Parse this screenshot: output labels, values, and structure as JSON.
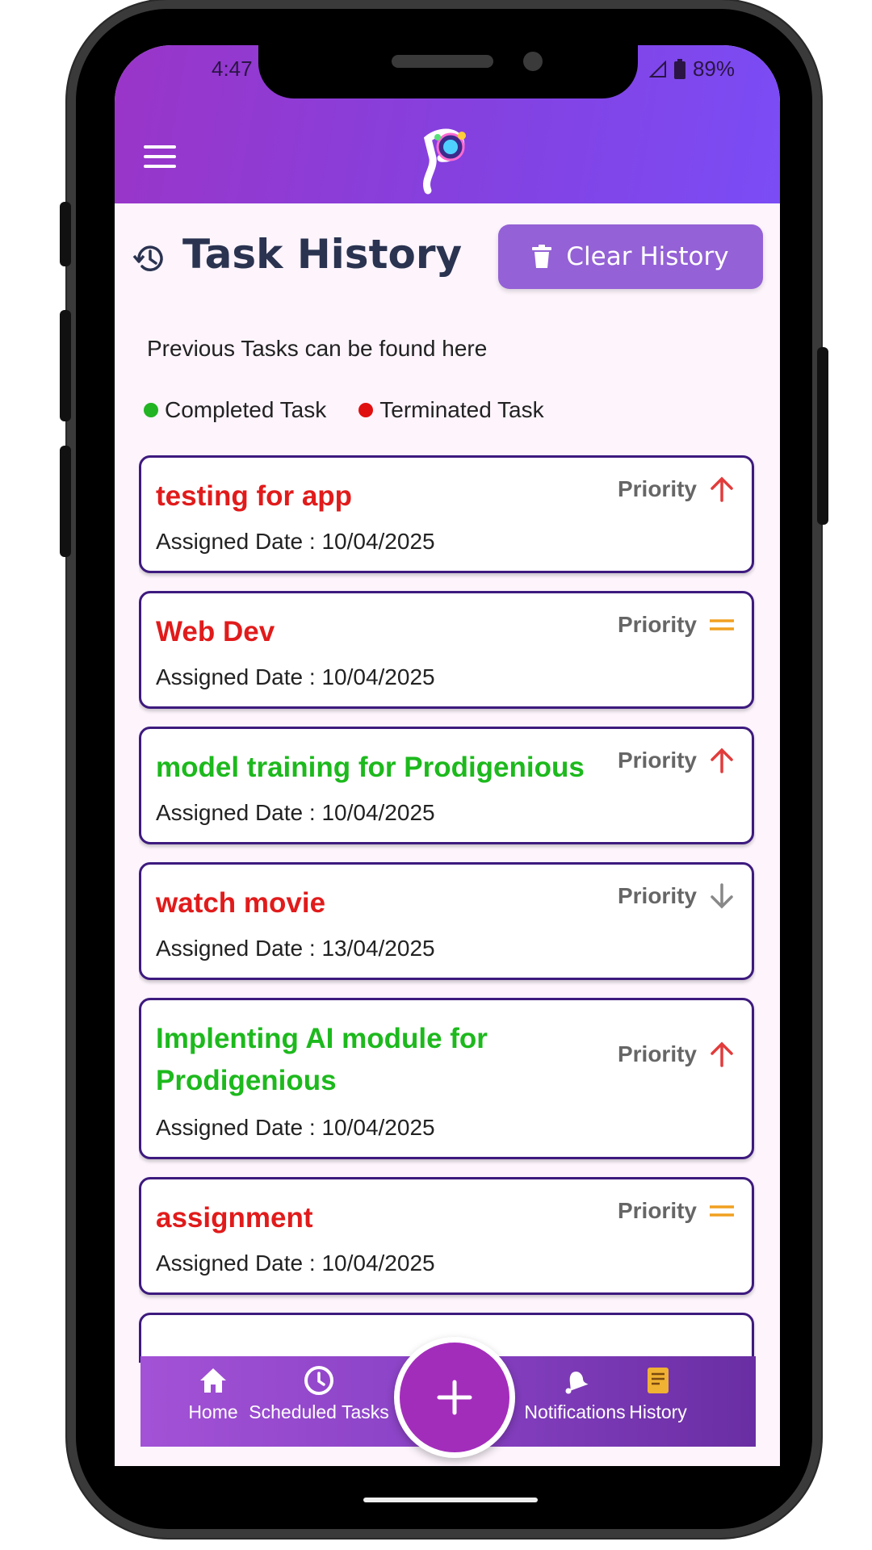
{
  "status_bar": {
    "time": "4:47",
    "battery": "89%"
  },
  "header": {
    "logo_icon": "prodigenious-logo",
    "menu_icon": "hamburger-menu-icon"
  },
  "page": {
    "title": "Task History",
    "clear_button_label": "Clear History",
    "subtitle": "Previous Tasks can be found here"
  },
  "legend": [
    {
      "label": "Completed Task",
      "color": "#22b422"
    },
    {
      "label": "Terminated Task",
      "color": "#e01010"
    }
  ],
  "colors": {
    "completed": "#1db91d",
    "terminated": "#e11b1b",
    "priority_high": "#e23b3b",
    "priority_medium": "#f0a020",
    "priority_low": "#888888",
    "accent": "#9461d6"
  },
  "tasks": [
    {
      "name": "testing for app",
      "status": "terminated",
      "priority_label": "Priority",
      "priority_icon": "arrow-up-icon",
      "date": "Assigned Date : 10/04/2025"
    },
    {
      "name": "Web Dev",
      "status": "terminated",
      "priority_label": "Priority",
      "priority_icon": "equals-icon",
      "date": "Assigned Date : 10/04/2025"
    },
    {
      "name": "model training for Prodigenious",
      "status": "completed",
      "priority_label": "Priority",
      "priority_icon": "arrow-up-icon",
      "date": "Assigned Date : 10/04/2025"
    },
    {
      "name": "watch movie",
      "status": "terminated",
      "priority_label": "Priority",
      "priority_icon": "arrow-down-icon",
      "date": "Assigned Date : 13/04/2025"
    },
    {
      "name": "Implenting AI module for Prodigenious",
      "status": "completed",
      "priority_label": "Priority",
      "priority_icon": "arrow-up-icon",
      "date": "Assigned Date : 10/04/2025"
    },
    {
      "name": "assignment",
      "status": "terminated",
      "priority_label": "Priority",
      "priority_icon": "equals-icon",
      "date": "Assigned Date : 10/04/2025"
    }
  ],
  "bottom_nav": [
    {
      "label": "Home",
      "icon": "home-icon"
    },
    {
      "label": "Scheduled Tasks",
      "icon": "clock-icon"
    },
    {
      "label": "Notifications",
      "icon": "bell-icon"
    },
    {
      "label": "History",
      "icon": "history-scroll-icon",
      "active": true
    }
  ],
  "fab_icon": "plus-icon"
}
